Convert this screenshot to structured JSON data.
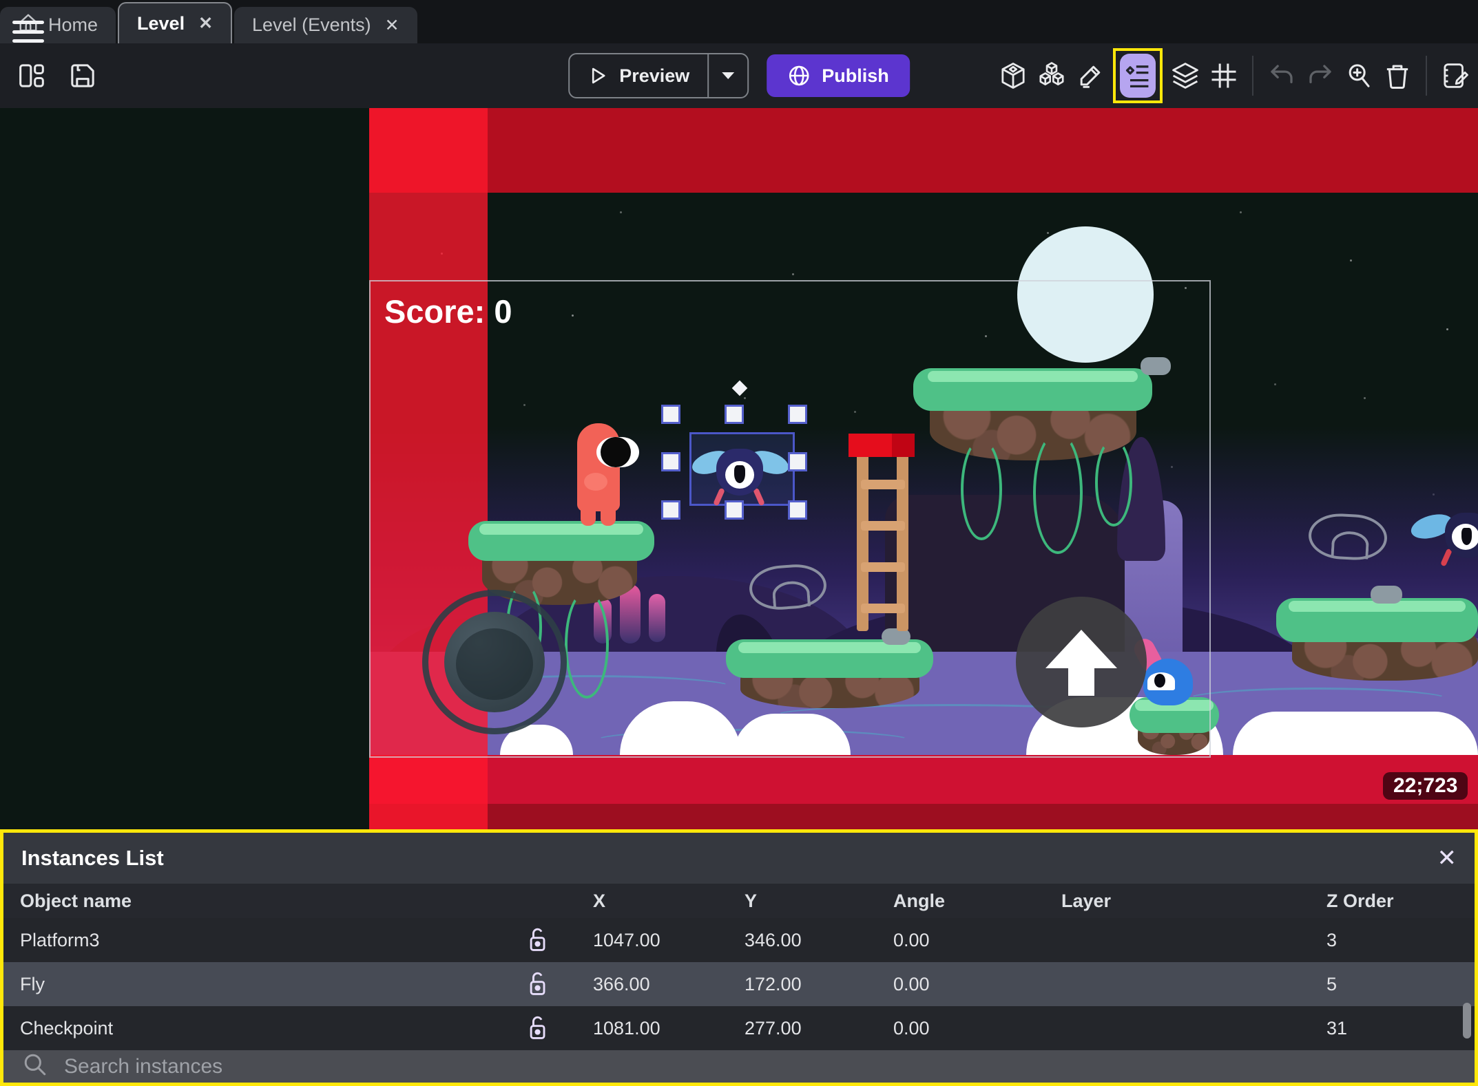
{
  "tab_bar": {
    "close_glyph": "✕",
    "tabs": [
      {
        "label": "Home",
        "active": false,
        "closable": false
      },
      {
        "label": "Level",
        "active": true,
        "closable": true
      },
      {
        "label": "Level (Events)",
        "active": false,
        "closable": true
      }
    ]
  },
  "toolbar": {
    "preview_label": "Preview",
    "publish_label": "Publish",
    "highlighted_icon": "instances-list-icon"
  },
  "scene": {
    "score_label": "Score: 0",
    "coordinates_badge": "22;723"
  },
  "instances_panel": {
    "title": "Instances List",
    "close_glyph": "✕",
    "columns": [
      "Object name",
      "X",
      "Y",
      "Angle",
      "Layer",
      "Z Order"
    ],
    "rows": [
      {
        "name": "Platform3",
        "x": "1047.00",
        "y": "346.00",
        "angle": "0.00",
        "layer": "",
        "z_order": "3"
      },
      {
        "name": "Fly",
        "x": "366.00",
        "y": "172.00",
        "angle": "0.00",
        "layer": "",
        "z_order": "5"
      },
      {
        "name": "Checkpoint",
        "x": "1081.00",
        "y": "277.00",
        "angle": "0.00",
        "layer": "",
        "z_order": "31"
      }
    ],
    "search_placeholder": "Search instances"
  },
  "colors": {
    "accent_purple": "#5c35cf",
    "highlight_purple": "#b6a5f0",
    "annotation_yellow": "#ffe70a",
    "selection_blue": "#5560cc",
    "red_zone": "#cf1132"
  }
}
